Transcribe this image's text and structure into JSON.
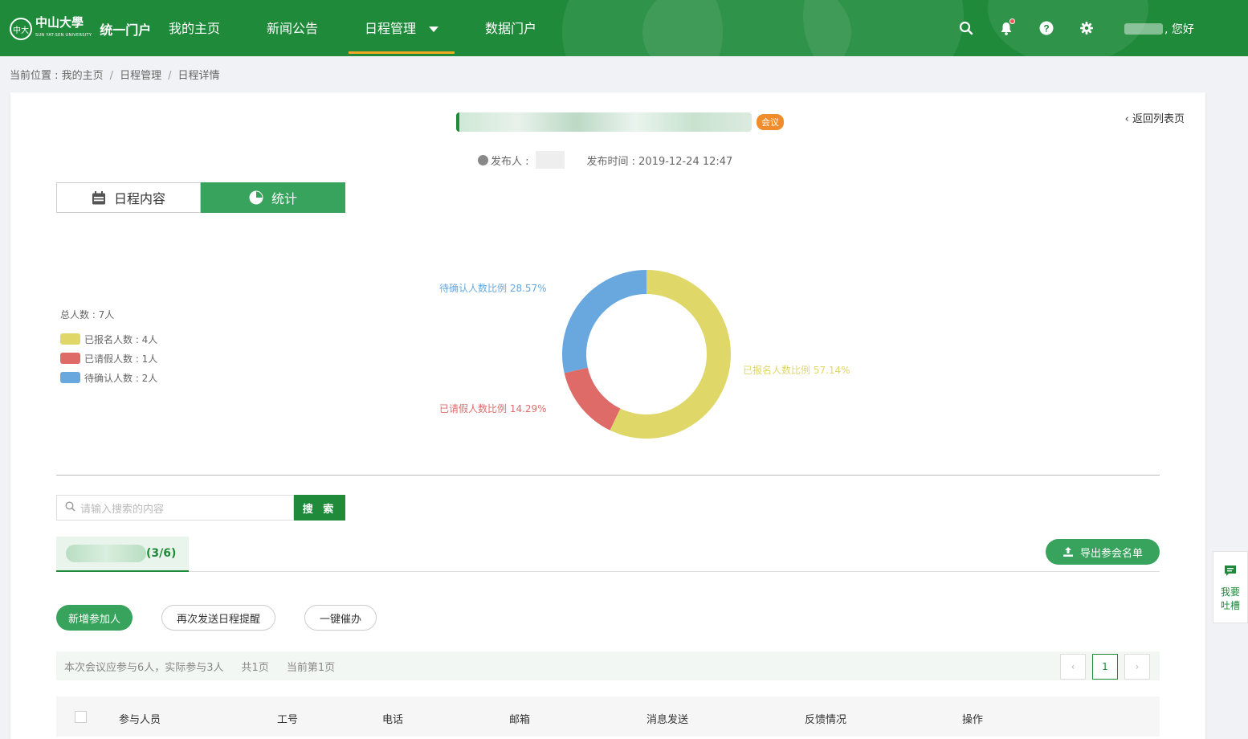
{
  "header": {
    "logo": {
      "seal": "中大",
      "name": "中山大學",
      "subtitle": "SUN YAT-SEN UNIVERSITY",
      "portal": "统一门户"
    },
    "nav": [
      {
        "label": "我的主页"
      },
      {
        "label": "新闻公告"
      },
      {
        "label": "日程管理",
        "active": true,
        "has_dropdown": true
      },
      {
        "label": "数据门户"
      }
    ],
    "icons": [
      "search-icon",
      "bell-icon",
      "help-icon",
      "gear-icon"
    ],
    "user_greeting": ", 您好"
  },
  "breadcrumb": {
    "prefix": "当前位置 : ",
    "items": [
      "我的主页",
      "日程管理",
      "日程详情"
    ]
  },
  "event": {
    "tag": "会议",
    "back_link": "返回列表页",
    "publisher_label": "发布人 :",
    "publish_time": "发布时间 : 2019-12-24 12:47"
  },
  "tabs": [
    {
      "label": "日程内容",
      "icon": "calendar-icon"
    },
    {
      "label": "统计",
      "icon": "pie-chart-icon",
      "active": true
    }
  ],
  "legend": {
    "total": "总人数 : 7人",
    "items": [
      {
        "label": "已报名人数 : 4人",
        "color": "#dfd768"
      },
      {
        "label": "已请假人数 : 1人",
        "color": "#df6b69"
      },
      {
        "label": "待确认人数 : 2人",
        "color": "#68a8de"
      }
    ]
  },
  "chart_data": {
    "type": "pie",
    "donut": true,
    "slices": [
      {
        "name": "已报名人数比例",
        "value": 4,
        "percent": 57.14,
        "label": "已报名人数比例 57.14%",
        "color": "#dfd768"
      },
      {
        "name": "已请假人数比例",
        "value": 1,
        "percent": 14.29,
        "label": "已请假人数比例 14.29%",
        "color": "#df6b69"
      },
      {
        "name": "待确认人数比例",
        "value": 2,
        "percent": 28.57,
        "label": "待确认人数比例 28.57%",
        "color": "#68a8de"
      }
    ]
  },
  "search": {
    "placeholder": "请输入搜索的内容",
    "button": "搜 索"
  },
  "sub_tab": {
    "count": "(3/6)"
  },
  "export_button": "导出参会名单",
  "actions": {
    "add": "新增参加人",
    "resend": "再次发送日程提醒",
    "urge": "一键催办"
  },
  "summary": {
    "text": "本次会议应参与6人，实际参与3人",
    "total_pages": "共1页",
    "current_page": "当前第1页"
  },
  "pagination": {
    "prev": "‹",
    "page": "1",
    "next": "›"
  },
  "table": {
    "columns": [
      "参与人员",
      "工号",
      "电话",
      "邮箱",
      "消息发送",
      "反馈情况",
      "操作"
    ]
  },
  "feedback": {
    "label_1": "我要",
    "label_2": "吐槽"
  },
  "colors": {
    "brand_green": "#1e8a3a",
    "accent_orange": "#f5a623"
  }
}
